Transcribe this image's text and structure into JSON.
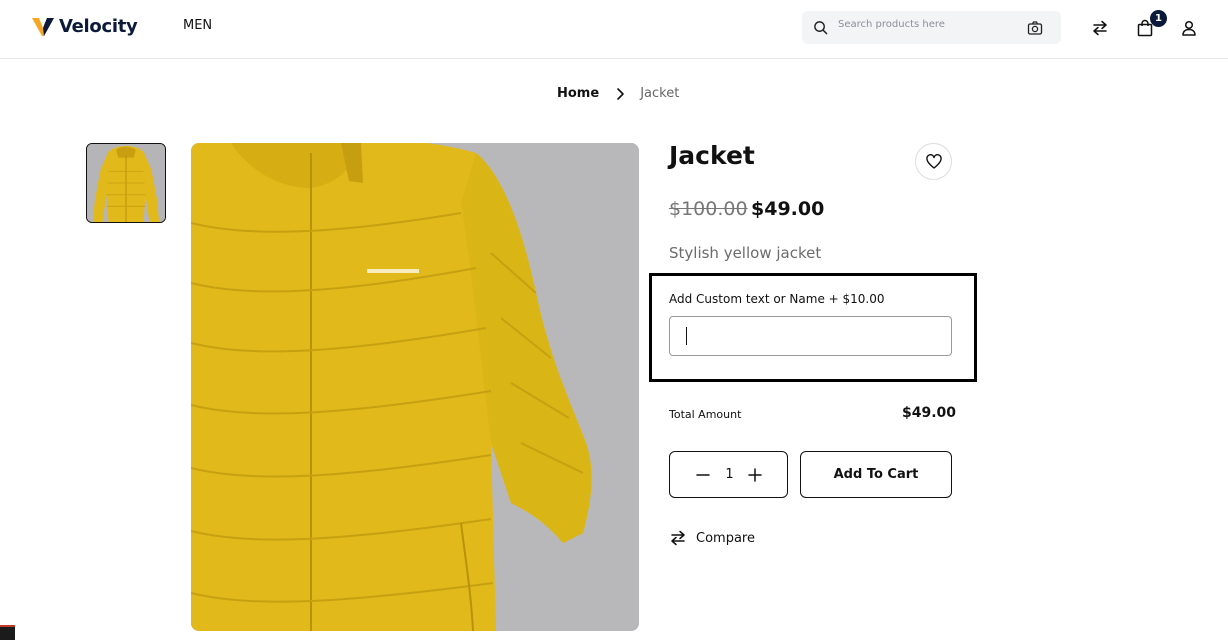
{
  "brand": {
    "name": "Velocity",
    "accent": "#f5a623",
    "dark": "#0b1a3a"
  },
  "nav": {
    "men": "MEN"
  },
  "search": {
    "placeholder": "Search products here"
  },
  "header_icons": {
    "compare": "compare-arrows-icon",
    "cart": "shopping-bag-icon",
    "account": "user-icon",
    "cart_count": "1"
  },
  "breadcrumb": {
    "home": "Home",
    "current": "Jacket"
  },
  "product": {
    "title": "Jacket",
    "old_price": "$100.00",
    "price": "$49.00",
    "description": "Stylish yellow jacket",
    "image_color": "#e2b91a"
  },
  "customization": {
    "label": "Add Custom text or Name + $10.00",
    "value": ""
  },
  "total": {
    "label": "Total Amount",
    "value": "$49.00"
  },
  "quantity": {
    "value": "1"
  },
  "actions": {
    "add_to_cart": "Add To Cart",
    "compare": "Compare"
  }
}
